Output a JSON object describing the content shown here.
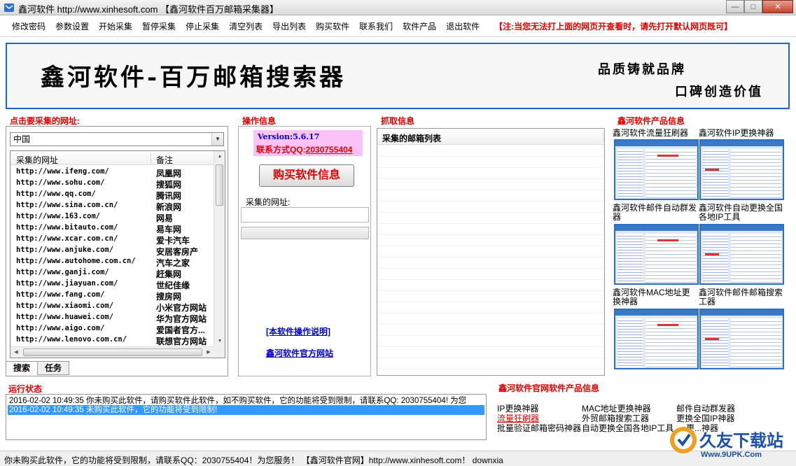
{
  "window": {
    "title": "鑫河软件 http://www.xinhesoft.com 【鑫河软件百万邮箱采集器】",
    "controls": {
      "minimize": "—",
      "maximize": "□",
      "close": "✕"
    }
  },
  "menu": {
    "items": [
      "修改密码",
      "参数设置",
      "开始采集",
      "暂停采集",
      "停止采集",
      "清空列表",
      "导出列表",
      "购买软件",
      "联系我们",
      "软件产品",
      "退出软件"
    ],
    "notice": "【注:当您无法打上面的网页开查看时，请先打开默认网页既可】"
  },
  "banner": {
    "title": "鑫河软件-百万邮箱搜索器",
    "slogan1": "品质铸就品牌",
    "slogan2": "口碑创造价值"
  },
  "left": {
    "section_title": "点击要采集的网址:",
    "region_selected": "中国",
    "columns": [
      "采集的网址",
      "备注"
    ],
    "rows": [
      {
        "url": "http://www.ifeng.com/",
        "note": "凤凰网"
      },
      {
        "url": "http://www.sohu.com/",
        "note": "搜狐网"
      },
      {
        "url": "http://www.qq.com/",
        "note": "腾讯网"
      },
      {
        "url": "http://www.sina.com.cn/",
        "note": "新浪网"
      },
      {
        "url": "http://www.163.com/",
        "note": "网易"
      },
      {
        "url": "http://www.bitauto.com/",
        "note": "易车网"
      },
      {
        "url": "http://www.xcar.com.cn/",
        "note": "爱卡汽车"
      },
      {
        "url": "http://www.anjuke.com/",
        "note": "安居客房产"
      },
      {
        "url": "http://www.autohome.com.cn/",
        "note": "汽车之家"
      },
      {
        "url": "http://www.ganji.com/",
        "note": "赶集网"
      },
      {
        "url": "http://www.jiayuan.com/",
        "note": "世纪佳缘"
      },
      {
        "url": "http://www.fang.com/",
        "note": "搜房网"
      },
      {
        "url": "http://www.xiaomi.com/",
        "note": "小米官方网站"
      },
      {
        "url": "http://www.huawei.com/",
        "note": "华为官方网站"
      },
      {
        "url": "http://www.aigo.com/",
        "note": "爱国者官方..."
      },
      {
        "url": "http://www.lenovo.com.cn/",
        "note": "联想官方网站"
      }
    ],
    "tabs": [
      "搜索",
      "任务"
    ]
  },
  "middle": {
    "section_title": "操作信息",
    "version": "Version:5.6.17",
    "contact_label": "联系方式QQ:",
    "contact_qq": "2030755404",
    "buy_button": "购买软件信息",
    "url_label": "采集的网址:",
    "url_value": "",
    "progress": 0,
    "link_manual": "[本软件操作说明]",
    "link_site": "鑫河软件官方网站"
  },
  "capture": {
    "section_title": "抓取信息",
    "column": "采集的邮箱列表"
  },
  "products": {
    "section_title": "鑫河软件产品信息",
    "items": [
      "鑫河软件流量狂刷器",
      "鑫河软件IP更换神器",
      "鑫河软件邮件自动群发器",
      "鑫河软件自动更换全国各地IP工具",
      "鑫河软件MAC地址更换神器",
      "鑫河软件邮件邮箱搜索工器"
    ]
  },
  "status": {
    "section_title": "运行状态",
    "log": [
      "2016-02-02 10:49:35 你未购买此软件，请购买软件此软件，如不购买软件，它的功能将受到限制，请联系QQ: 2030755404! 为您",
      "2016-02-02 10:49:35 未购买此软件，它的功能将受到限制!"
    ]
  },
  "site_products": {
    "section_title": "鑫河软件官网软件产品信息",
    "links": [
      [
        "IP更换神器",
        "MAC地址更换神器",
        "邮件自动群发器"
      ],
      [
        "流量狂刷器",
        "外贸邮箱搜索工器",
        "更换全国IP神器"
      ],
      [
        "批量验证邮箱密码神器",
        "自动更换全国各地IP工具",
        "更...神器"
      ]
    ]
  },
  "statusbar": {
    "text": "你未购买此软件，它的功能将受到限制，请联系QQ：2030755404！为您服务！ 【鑫河软件官网】http://www.xinhesoft.com！    downxia"
  },
  "watermark": {
    "name": "久友下载站",
    "url": "Www.9UPK.Com"
  },
  "colors": {
    "accent_red": "#e00000",
    "link_blue": "#0000cc",
    "border_blue": "#1c66cc",
    "version_bg": "#fac2f5",
    "selection": "#3399ff"
  }
}
